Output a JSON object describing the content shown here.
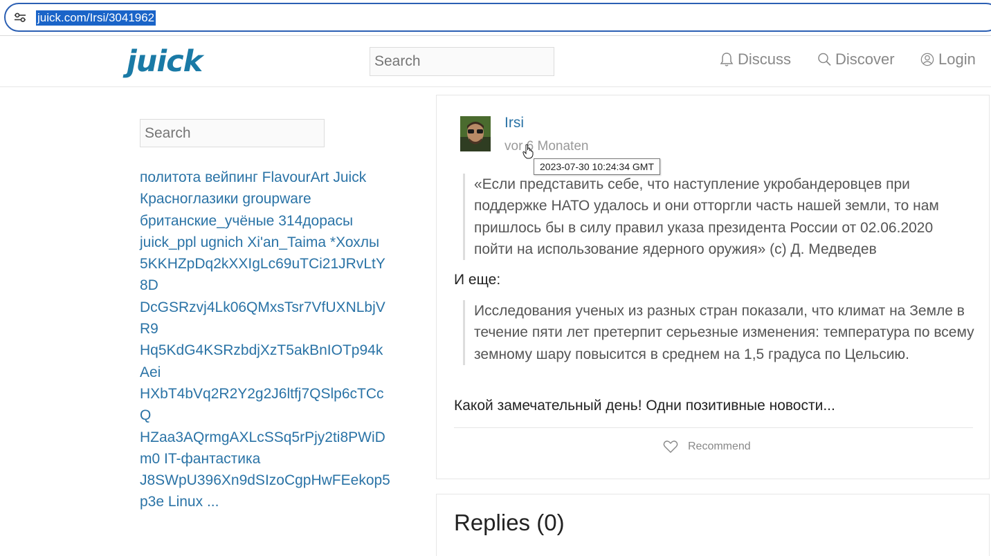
{
  "browser": {
    "url": "juick.com/Irsi/3041962"
  },
  "header": {
    "logo_text": "juick",
    "search_placeholder": "Search",
    "nav": [
      {
        "label": "Discuss",
        "icon": "bell-icon"
      },
      {
        "label": "Discover",
        "icon": "search-icon"
      },
      {
        "label": "Login",
        "icon": "user-icon"
      }
    ]
  },
  "sidebar": {
    "search_placeholder": "Search",
    "tags": [
      "политота",
      "вейпинг",
      "FlavourArt",
      "Juick",
      "Красноглазики",
      "groupware",
      "британские_учёные",
      "314дорасы",
      "juick_ppl",
      "ugnich",
      "Xi'an_Taima",
      "*Хохлы",
      "5KKHZpDq2kXXIgLc69uTCi21JRvLtY8D",
      "DcGSRzvj4Lk06QMxsTsr7VfUXNLbjVR9",
      "Hq5KdG4KSRzbdjXzT5akBnIOTp94kAei",
      "HXbT4bVq2R2Y2g2J6ltfj7QSlp6cTCcQ",
      "HZaa3AQrmgAXLcSSq5rPjy2ti8PWiDm0",
      "IT-фантастика",
      "J8SWpU396Xn9dSIzoCgpHwFEekop5p3e",
      "Linux",
      "..."
    ]
  },
  "post": {
    "author": "Irsi",
    "time": "vor 6 Monaten",
    "tooltip": "2023-07-30 10:24:34 GMT",
    "quote1": "«Если представить себе, что наступление укробандеровцев при поддержке НАТО удалось и они отторгли часть нашей земли, то нам пришлось бы в силу правил указа президента России от 02.06.2020 пойти на использование ядерного оружия» (с) Д. Медведев",
    "para1": "И еще:",
    "quote2": "Исследования ученых из разных стран показали, что климат на Земле в течение пяти лет претерпит серьезные изменения: температура по всему земному шару повысится в среднем на 1,5 градуса по Цельсию.",
    "para2": "Какой замечательный день! Одни позитивные новости...",
    "recommend_label": "Recommend"
  },
  "replies": {
    "title": "Replies (0)"
  }
}
